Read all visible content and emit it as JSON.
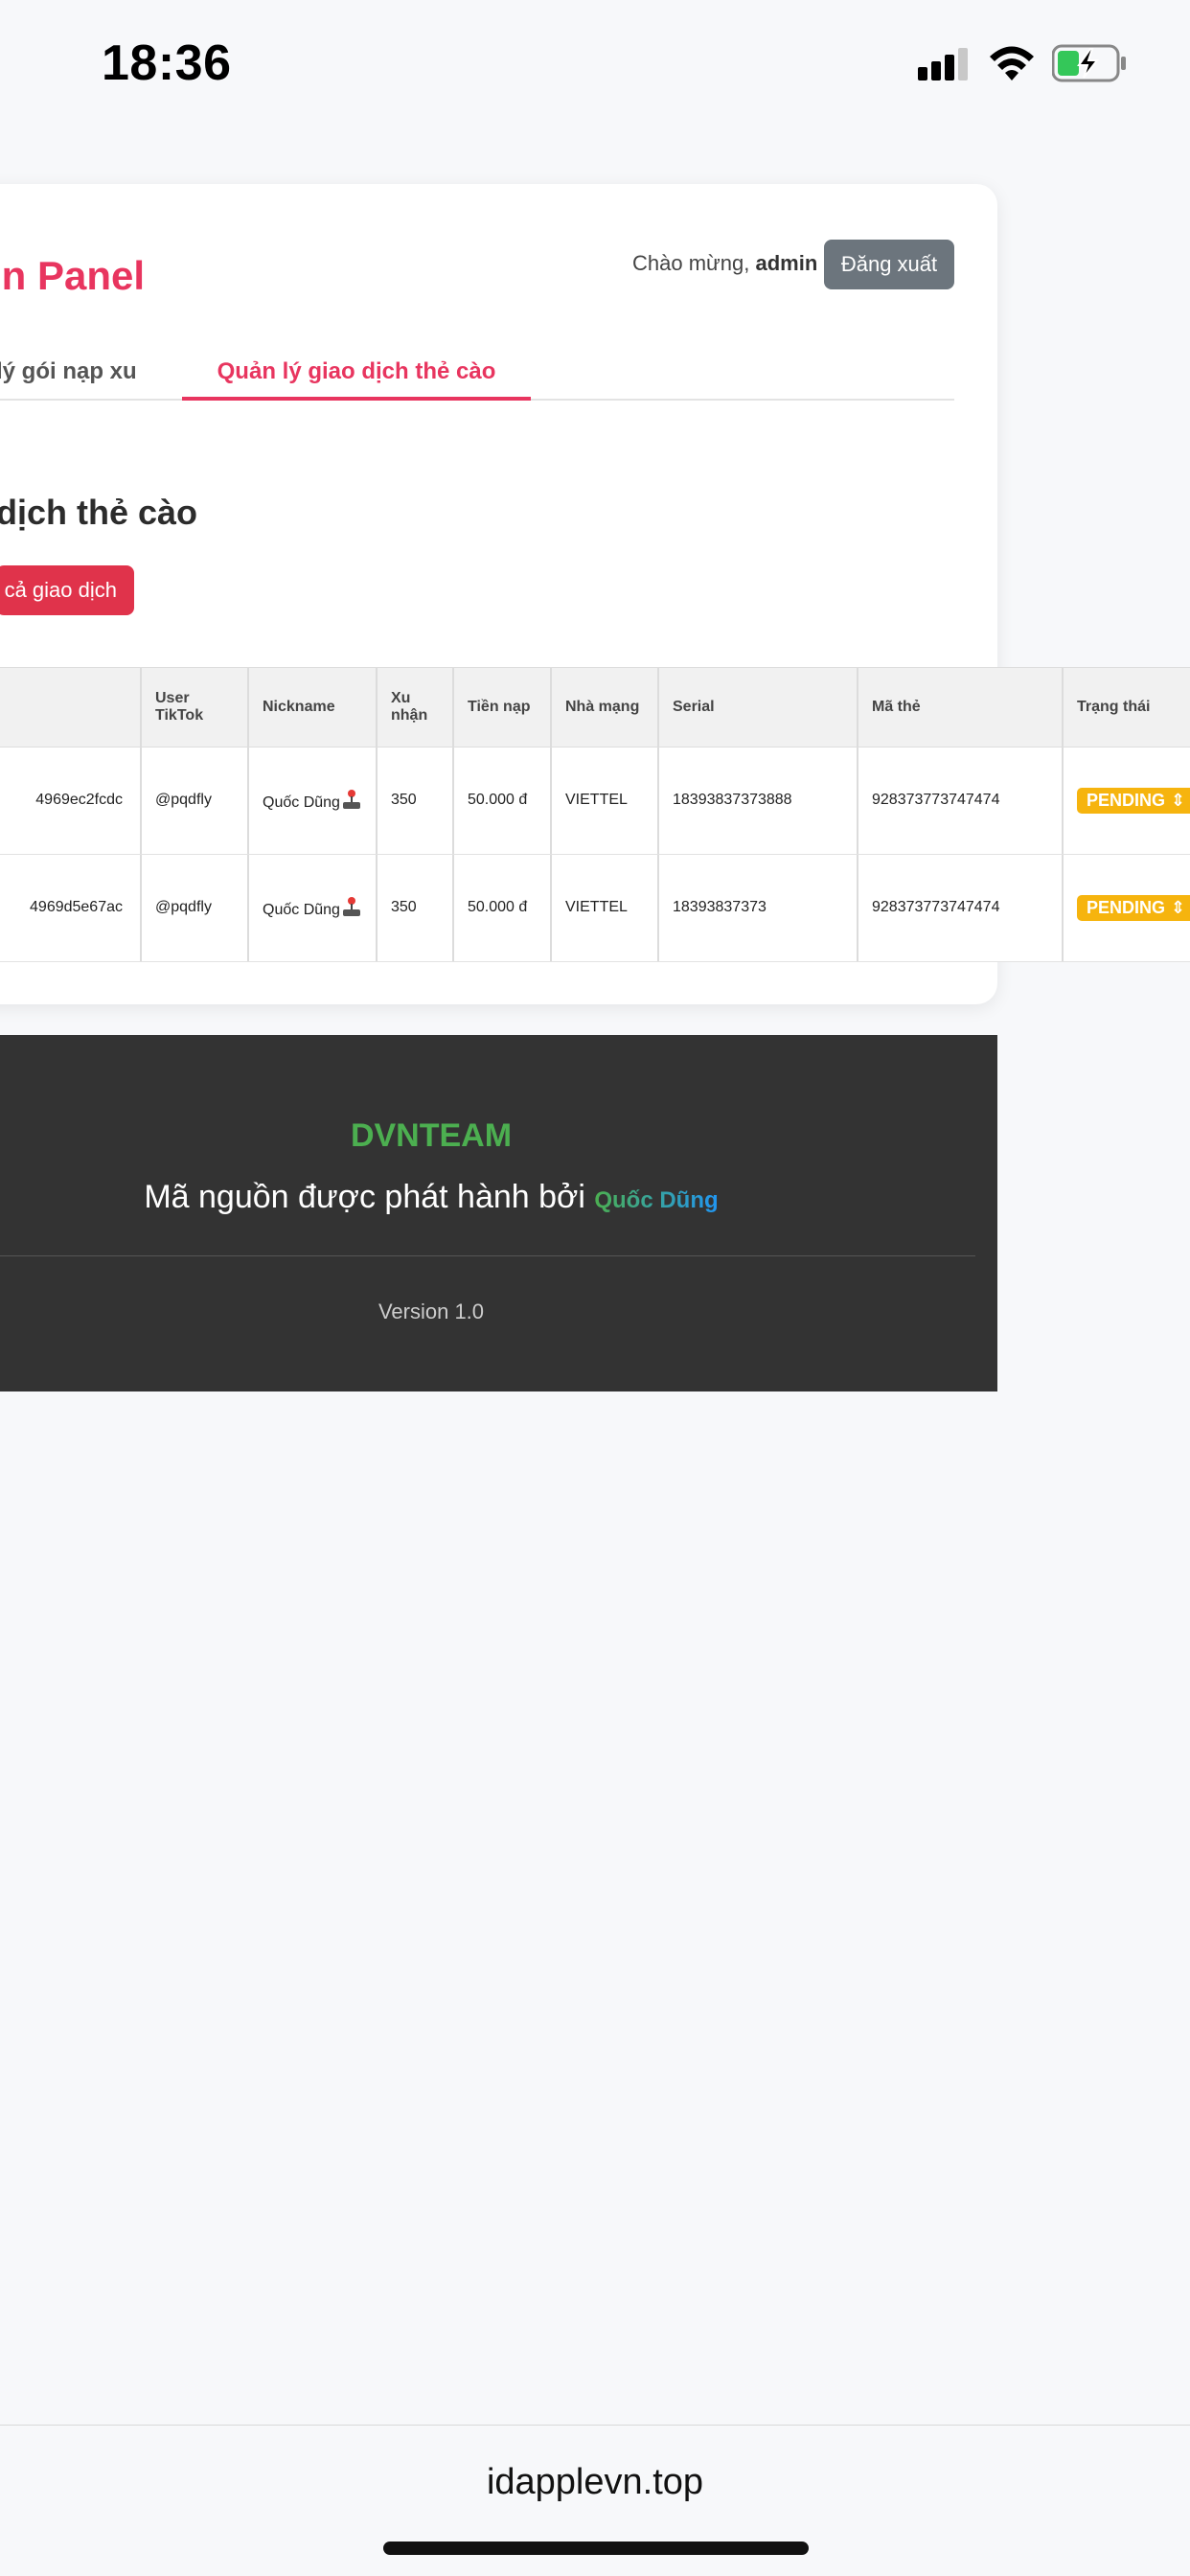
{
  "status_bar": {
    "time": "18:36",
    "icons": [
      "cellular-signal-icon",
      "wifi-icon",
      "battery-charging-icon"
    ]
  },
  "header": {
    "title": "in Panel",
    "welcome_prefix": "Chào mừng, ",
    "username": "admin",
    "logout_label": "Đăng xuất"
  },
  "tabs": [
    {
      "label": "lý gói nạp xu",
      "active": false
    },
    {
      "label": "Quản lý giao dịch thẻ cào",
      "active": true
    }
  ],
  "section": {
    "title": "dịch thẻ cào",
    "delete_all_label": "cả giao dịch"
  },
  "table": {
    "headers": [
      "User TikTok",
      "Nickname",
      "Xu nhận",
      "Tiền nạp",
      "Nhà mạng",
      "Serial",
      "Mã thẻ",
      "Trạng thái"
    ],
    "rows": [
      {
        "id": "4969ec2fcdc",
        "user": "@pqdfly",
        "nickname": "Quốc Dũng",
        "xu": "350",
        "money": "50.000 đ",
        "carrier": "VIETTEL",
        "serial": "18393837373888",
        "code": "928373773747474",
        "status": "PENDING"
      },
      {
        "id": "4969d5e67ac",
        "user": "@pqdfly",
        "nickname": "Quốc Dũng",
        "xu": "350",
        "money": "50.000 đ",
        "carrier": "VIETTEL",
        "serial": "18393837373",
        "code": "928373773747474",
        "status": "PENDING"
      }
    ]
  },
  "footer": {
    "brand": "DVNTEAM",
    "credit_text": "Mã nguồn được phát hành bởi ",
    "author": "Quốc Dũng",
    "version": "Version 1.0"
  },
  "browser": {
    "url": "idapplevn.top"
  },
  "colors": {
    "accent": "#e8355f",
    "danger": "#e0334b",
    "logout": "#6c757d",
    "pending": "#f6b40e",
    "footer_bg": "#333333",
    "brand_green": "#4caf50"
  }
}
